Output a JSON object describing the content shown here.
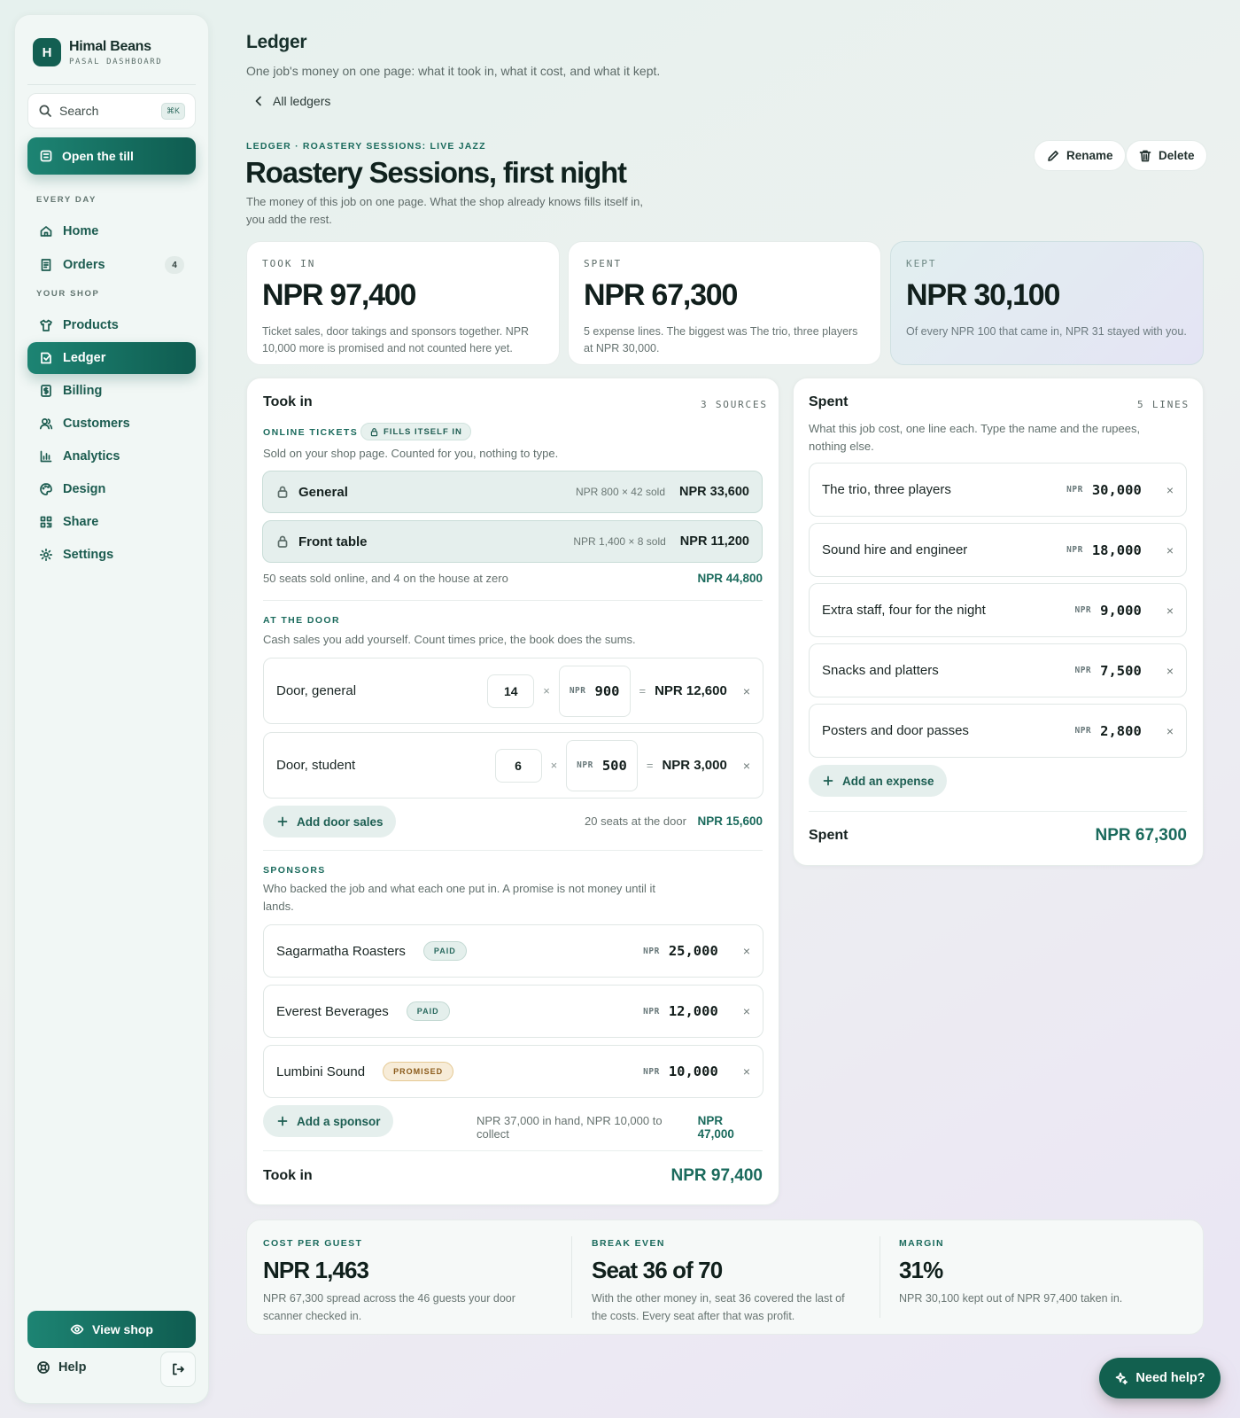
{
  "sidebar": {
    "brand_initial": "H",
    "brand_name": "Himal Beans",
    "brand_sub": "PASAL DASHBOARD",
    "search_placeholder": "Search",
    "search_shortcut": "⌘K",
    "till_label": "Open the till",
    "section_everyday": "EVERY DAY",
    "home": "Home",
    "orders": "Orders",
    "orders_count": "4",
    "section_shop": "YOUR SHOP",
    "products": "Products",
    "ledger": "Ledger",
    "billing": "Billing",
    "customers": "Customers",
    "analytics": "Analytics",
    "design": "Design",
    "share": "Share",
    "settings": "Settings",
    "view_shop": "View shop",
    "help": "Help"
  },
  "header": {
    "title": "Ledger",
    "subtitle": "One job's money on one page: what it took in, what it cost, and what it kept.",
    "back": "All ledgers"
  },
  "page": {
    "eyebrow": "LEDGER · ROASTERY SESSIONS: LIVE JAZZ",
    "title": "Roastery Sessions, first night",
    "description": "The money of this job on one page. What the shop already knows fills itself in, you add the rest.",
    "rename": "Rename",
    "delete": "Delete"
  },
  "stats": {
    "took_label": "TOOK IN",
    "took_value": "NPR 97,400",
    "took_desc": "Ticket sales, door takings and sponsors together. NPR 10,000 more is promised and not counted here yet.",
    "spent_label": "SPENT",
    "spent_value": "NPR 67,300",
    "spent_desc": "5 expense lines. The biggest was The trio, three players at NPR 30,000.",
    "kept_label": "KEPT",
    "kept_value": "NPR 30,100",
    "kept_desc": "Of every NPR 100 that came in, NPR 31 stayed with you."
  },
  "tookin": {
    "title": "Took in",
    "count": "3 SOURCES",
    "online_label": "ONLINE TICKETS",
    "fills_badge": "FILLS ITSELF IN",
    "online_help": "Sold on your shop page. Counted for you, nothing to type.",
    "tickets": [
      {
        "name": "General",
        "meta": "NPR 800 × 42 sold",
        "amount": "NPR 33,600"
      },
      {
        "name": "Front table",
        "meta": "NPR 1,400 × 8 sold",
        "amount": "NPR 11,200"
      }
    ],
    "online_summary": "50 seats sold online, and 4 on the house at zero",
    "online_total": "NPR 44,800",
    "door_label": "AT THE DOOR",
    "door_help": "Cash sales you add yourself. Count times price, the book does the sums.",
    "door_rows": [
      {
        "name": "Door, general",
        "qty": "14",
        "cur": "NPR",
        "price": "900",
        "times": "×",
        "eq": "=",
        "total": "NPR 12,600",
        "x": "×"
      },
      {
        "name": "Door, student",
        "qty": "6",
        "cur": "NPR",
        "price": "500",
        "times": "×",
        "eq": "=",
        "total": "NPR 3,000",
        "x": "×"
      }
    ],
    "add_door": "Add door sales",
    "door_summary": "20 seats at the door",
    "door_total": "NPR 15,600",
    "sponsor_label": "SPONSORS",
    "sponsor_help": "Who backed the job and what each one put in. A promise is not money until it lands.",
    "sponsors": [
      {
        "name": "Sagarmatha Roasters",
        "status": "PAID",
        "cur": "NPR",
        "amount": "25,000",
        "x": "×"
      },
      {
        "name": "Everest Beverages",
        "status": "PAID",
        "cur": "NPR",
        "amount": "12,000",
        "x": "×"
      },
      {
        "name": "Lumbini Sound",
        "status": "PROMISED",
        "cur": "NPR",
        "amount": "10,000",
        "x": "×"
      }
    ],
    "add_sponsor": "Add a sponsor",
    "sponsor_summary": "NPR 37,000 in hand, NPR 10,000 to collect",
    "sponsor_total": "NPR 47,000",
    "footer_label": "Took in",
    "footer_total": "NPR 97,400"
  },
  "spent": {
    "title": "Spent",
    "count": "5 LINES",
    "help": "What this job cost, one line each. Type the name and the rupees, nothing else.",
    "lines": [
      {
        "name": "The trio, three players",
        "cur": "NPR",
        "amount": "30,000",
        "x": "×"
      },
      {
        "name": "Sound hire and engineer",
        "cur": "NPR",
        "amount": "18,000",
        "x": "×"
      },
      {
        "name": "Extra staff, four for the night",
        "cur": "NPR",
        "amount": "9,000",
        "x": "×"
      },
      {
        "name": "Snacks and platters",
        "cur": "NPR",
        "amount": "7,500",
        "x": "×"
      },
      {
        "name": "Posters and door passes",
        "cur": "NPR",
        "amount": "2,800",
        "x": "×"
      }
    ],
    "add": "Add an expense",
    "footer_label": "Spent",
    "footer_total": "NPR 67,300"
  },
  "summary": {
    "cpg_label": "COST PER GUEST",
    "cpg_value": "NPR 1,463",
    "cpg_desc": "NPR 67,300 spread across the 46 guests your door scanner checked in.",
    "be_label": "BREAK EVEN",
    "be_value": "Seat 36 of 70",
    "be_desc": "With the other money in, seat 36 covered the last of the costs. Every seat after that was profit.",
    "margin_label": "MARGIN",
    "margin_value": "31%",
    "margin_desc": "NPR 30,100 kept out of NPR 97,400 taken in."
  },
  "need_help": "Need help?"
}
